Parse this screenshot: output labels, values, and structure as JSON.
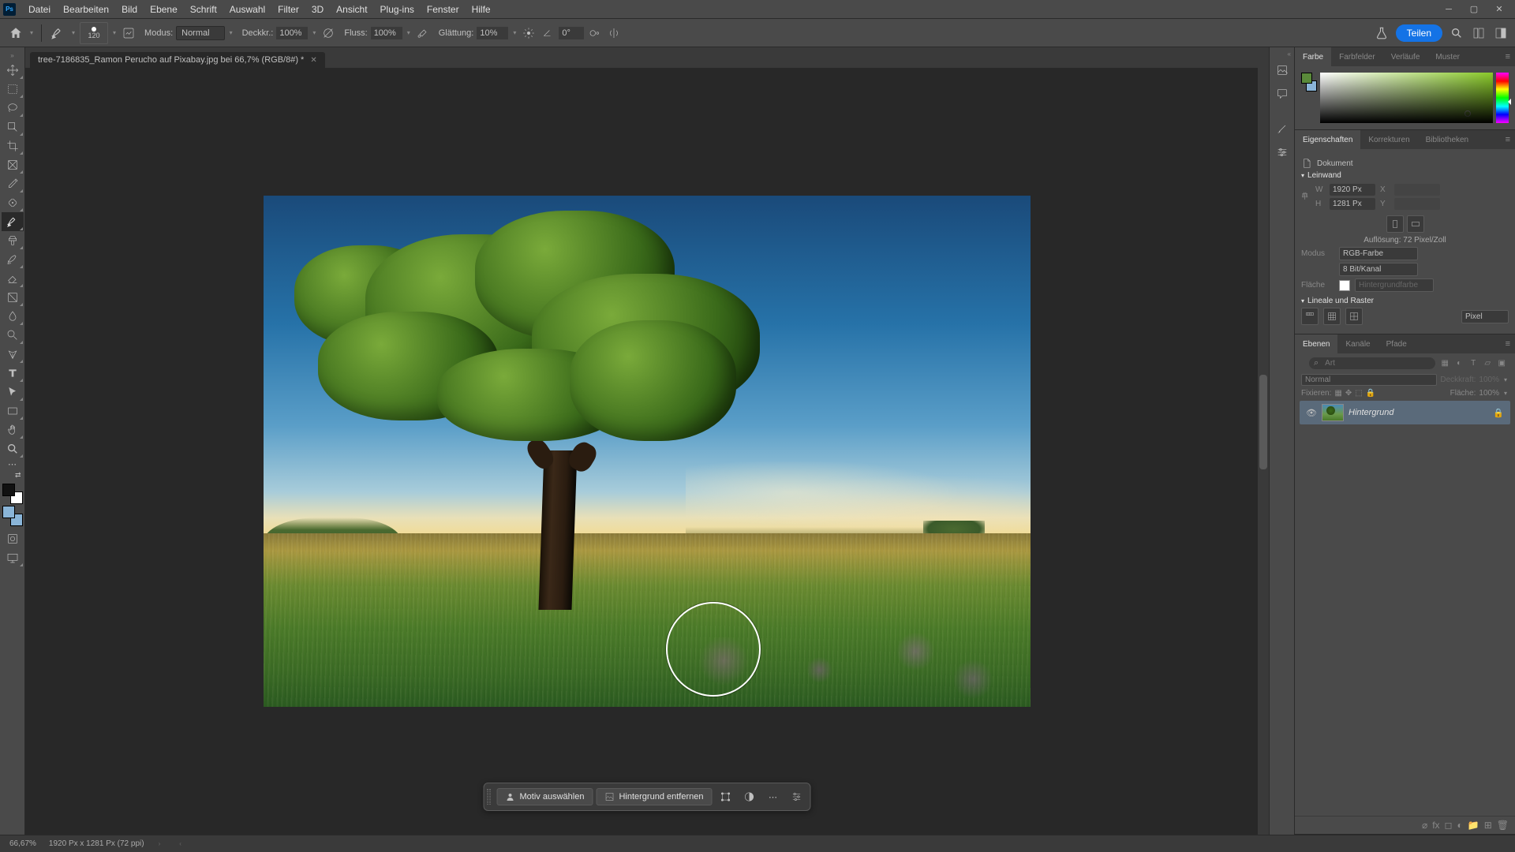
{
  "app": {
    "icon_text": "Ps"
  },
  "menu": {
    "items": [
      "Datei",
      "Bearbeiten",
      "Bild",
      "Ebene",
      "Schrift",
      "Auswahl",
      "Filter",
      "3D",
      "Ansicht",
      "Plug-ins",
      "Fenster",
      "Hilfe"
    ]
  },
  "options": {
    "brush_size": "120",
    "mode_label": "Modus:",
    "mode_value": "Normal",
    "opacity_label": "Deckkr.:",
    "opacity_value": "100%",
    "flow_label": "Fluss:",
    "flow_value": "100%",
    "smoothing_label": "Glättung:",
    "smoothing_value": "10%",
    "angle_value": "0°",
    "share_label": "Teilen"
  },
  "document": {
    "tab_title": "tree-7186835_Ramon Perucho auf Pixabay.jpg bei 66,7% (RGB/8#) *"
  },
  "context_toolbar": {
    "select_subject": "Motiv auswählen",
    "remove_bg": "Hintergrund entfernen"
  },
  "panels": {
    "color": {
      "tabs": [
        "Farbe",
        "Farbfelder",
        "Verläufe",
        "Muster"
      ]
    },
    "properties": {
      "tabs": [
        "Eigenschaften",
        "Korrekturen",
        "Bibliotheken"
      ],
      "doc_label": "Dokument",
      "canvas_section": "Leinwand",
      "w_label": "W",
      "w_value": "1920 Px",
      "x_label": "X",
      "h_label": "H",
      "h_value": "1281 Px",
      "y_label": "Y",
      "resolution": "Auflösung: 72 Pixel/Zoll",
      "mode_label": "Modus",
      "mode_value": "RGB-Farbe",
      "depth_value": "8 Bit/Kanal",
      "fill_label": "Fläche",
      "fill_value": "Hintergrundfarbe",
      "rulers_section": "Lineale und Raster",
      "units_value": "Pixel"
    },
    "layers": {
      "tabs": [
        "Ebenen",
        "Kanäle",
        "Pfade"
      ],
      "search_placeholder": "Art",
      "blend_mode": "Normal",
      "opacity_label": "Deckkraft:",
      "opacity_value": "100%",
      "lock_label": "Fixieren:",
      "fill_label": "Fläche:",
      "fill_value": "100%",
      "layer_name": "Hintergrund"
    }
  },
  "status": {
    "zoom": "66,67%",
    "doc_info": "1920 Px x 1281 Px (72 ppi)"
  }
}
